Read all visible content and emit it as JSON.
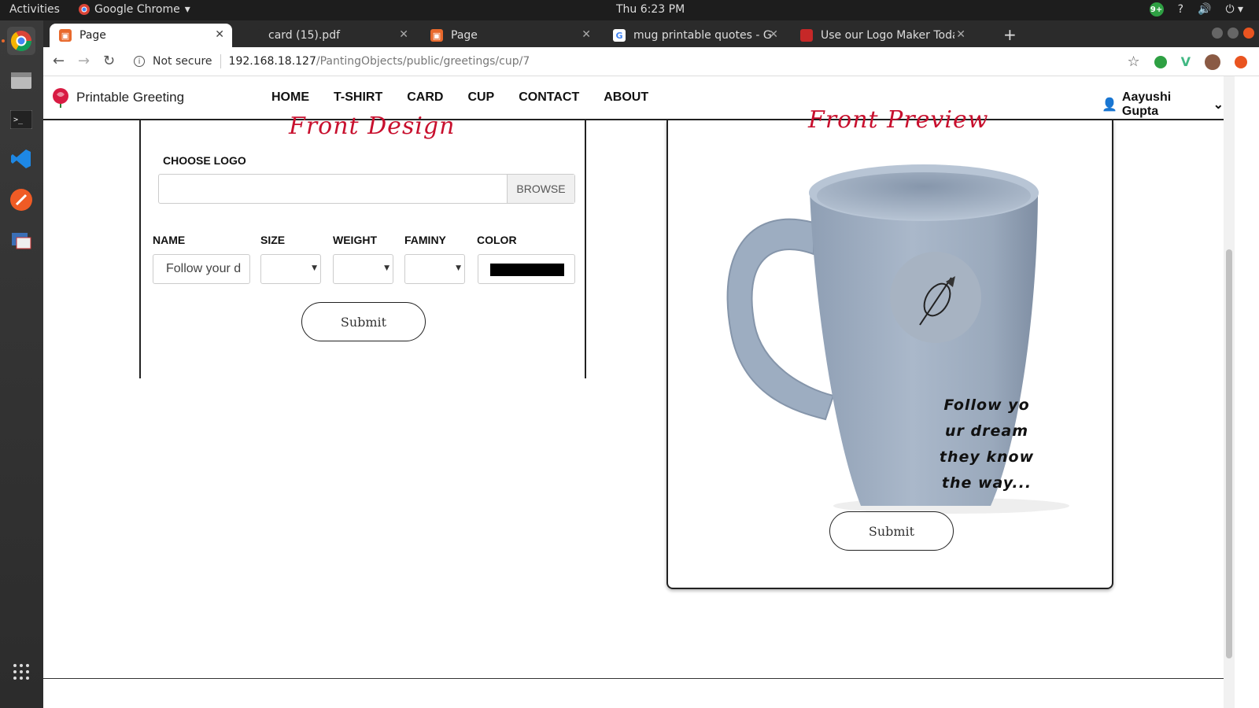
{
  "system": {
    "activities": "Activities",
    "app_name": "Google Chrome",
    "clock": "Thu  6:23 PM",
    "notif_count": "9+"
  },
  "tabs": [
    {
      "title": "Page"
    },
    {
      "title": "card (15).pdf"
    },
    {
      "title": "Page"
    },
    {
      "title": "mug printable quotes - Go"
    },
    {
      "title": "Use our Logo Maker Toda"
    }
  ],
  "address": {
    "security": "Not secure",
    "host": "192.168.18.127",
    "path": "/PantingObjects/public/greetings/cup/7"
  },
  "site": {
    "brand": "Printable Greeting",
    "menu": [
      "HOME",
      "T-SHIRT",
      "CARD",
      "CUP",
      "CONTACT",
      "ABOUT"
    ],
    "user": "Aayushi Gupta"
  },
  "design_form": {
    "title": "Front Design",
    "choose_logo": "CHOOSE LOGO",
    "browse": "BROWSE",
    "name_label": "NAME",
    "size_label": "SIZE",
    "weight_label": "WEIGHT",
    "family_label": "FAMINY",
    "color_label": "COLOR",
    "name_value": "Follow your d",
    "color_value": "#000000",
    "submit": "Submit"
  },
  "preview": {
    "title": "Front Preview",
    "mug_lines": [
      "Follow yo",
      "ur dream",
      "they know",
      "the way..."
    ],
    "submit": "Submit"
  }
}
